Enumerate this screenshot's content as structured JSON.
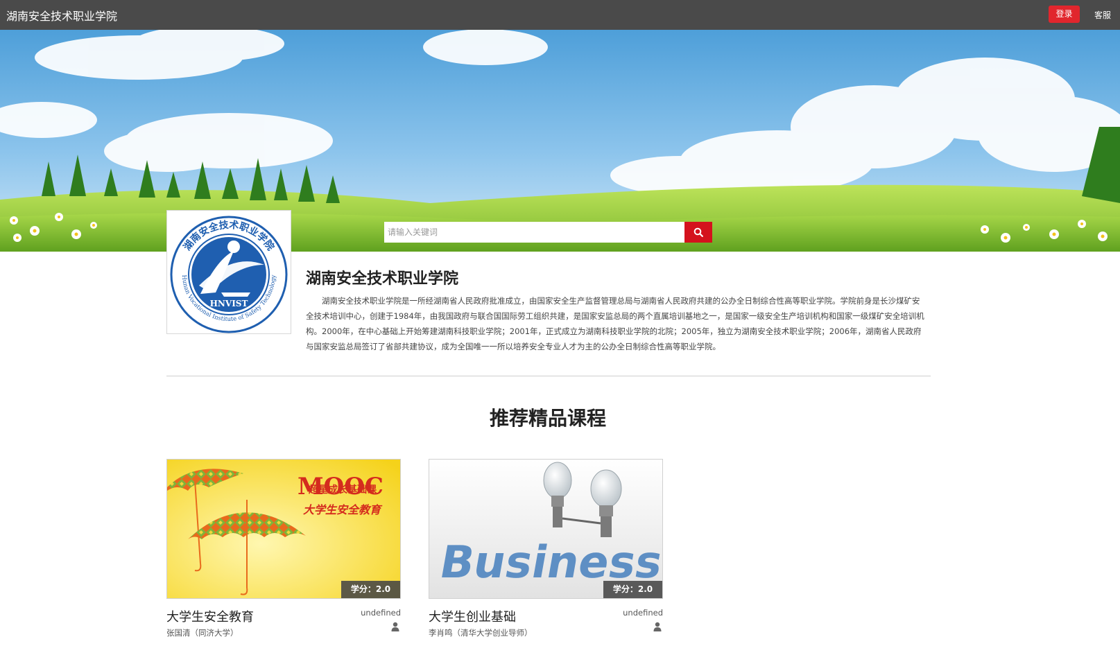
{
  "header": {
    "site_name": "湖南安全技术职业学院",
    "login_label": "登录",
    "service_label": "客服"
  },
  "search": {
    "placeholder": "请输入关键词",
    "button_icon": "search-icon"
  },
  "logo": {
    "badge_text": "HNVIST",
    "arc_top_text": "湖南安全技术职业学院",
    "arc_bottom_text": "Hunan Vocational Institute of Safety Technology"
  },
  "school": {
    "title": "湖南安全技术职业学院",
    "description": "湖南安全技术职业学院是一所经湖南省人民政府批准成立，由国家安全生产监督管理总局与湖南省人民政府共建的公办全日制综合性高等职业学院。学院前身是长沙煤矿安全技术培训中心，创建于1984年，由我国政府与联合国国际劳工组织共建，是国家安监总局的两个直属培训基地之一，是国家一级安全生产培训机构和国家一级煤矿安全培训机构。2000年，在中心基础上开始筹建湖南科技职业学院；2001年，正式成立为湖南科技职业学院的北院；2005年，独立为湖南安全技术职业学院；2006年，湖南省人民政府与国家安监总局签订了省部共建协议，成为全国唯一一所以培养安全专业人才为主的公办全日制综合性高等职业学院。"
  },
  "section": {
    "title": "推荐精品课程"
  },
  "courses": [
    {
      "name": "大学生安全教育",
      "teacher": "张国清（同济大学）",
      "credit": "学分：2.0",
      "meta": "undefined",
      "thumb_title": "MOOC",
      "thumb_line1": "超星成长基础课",
      "thumb_line2": "大学生安全教育"
    },
    {
      "name": "大学生创业基础",
      "teacher": "李肖鸣（清华大学创业导师）",
      "credit": "学分：2.0",
      "meta": "undefined",
      "thumb_word": "Business"
    }
  ],
  "colors": {
    "topbar": "#4a4a4a",
    "login": "#e1262d",
    "search_button": "#d4121d",
    "logo_blue": "#1f5fb0"
  }
}
